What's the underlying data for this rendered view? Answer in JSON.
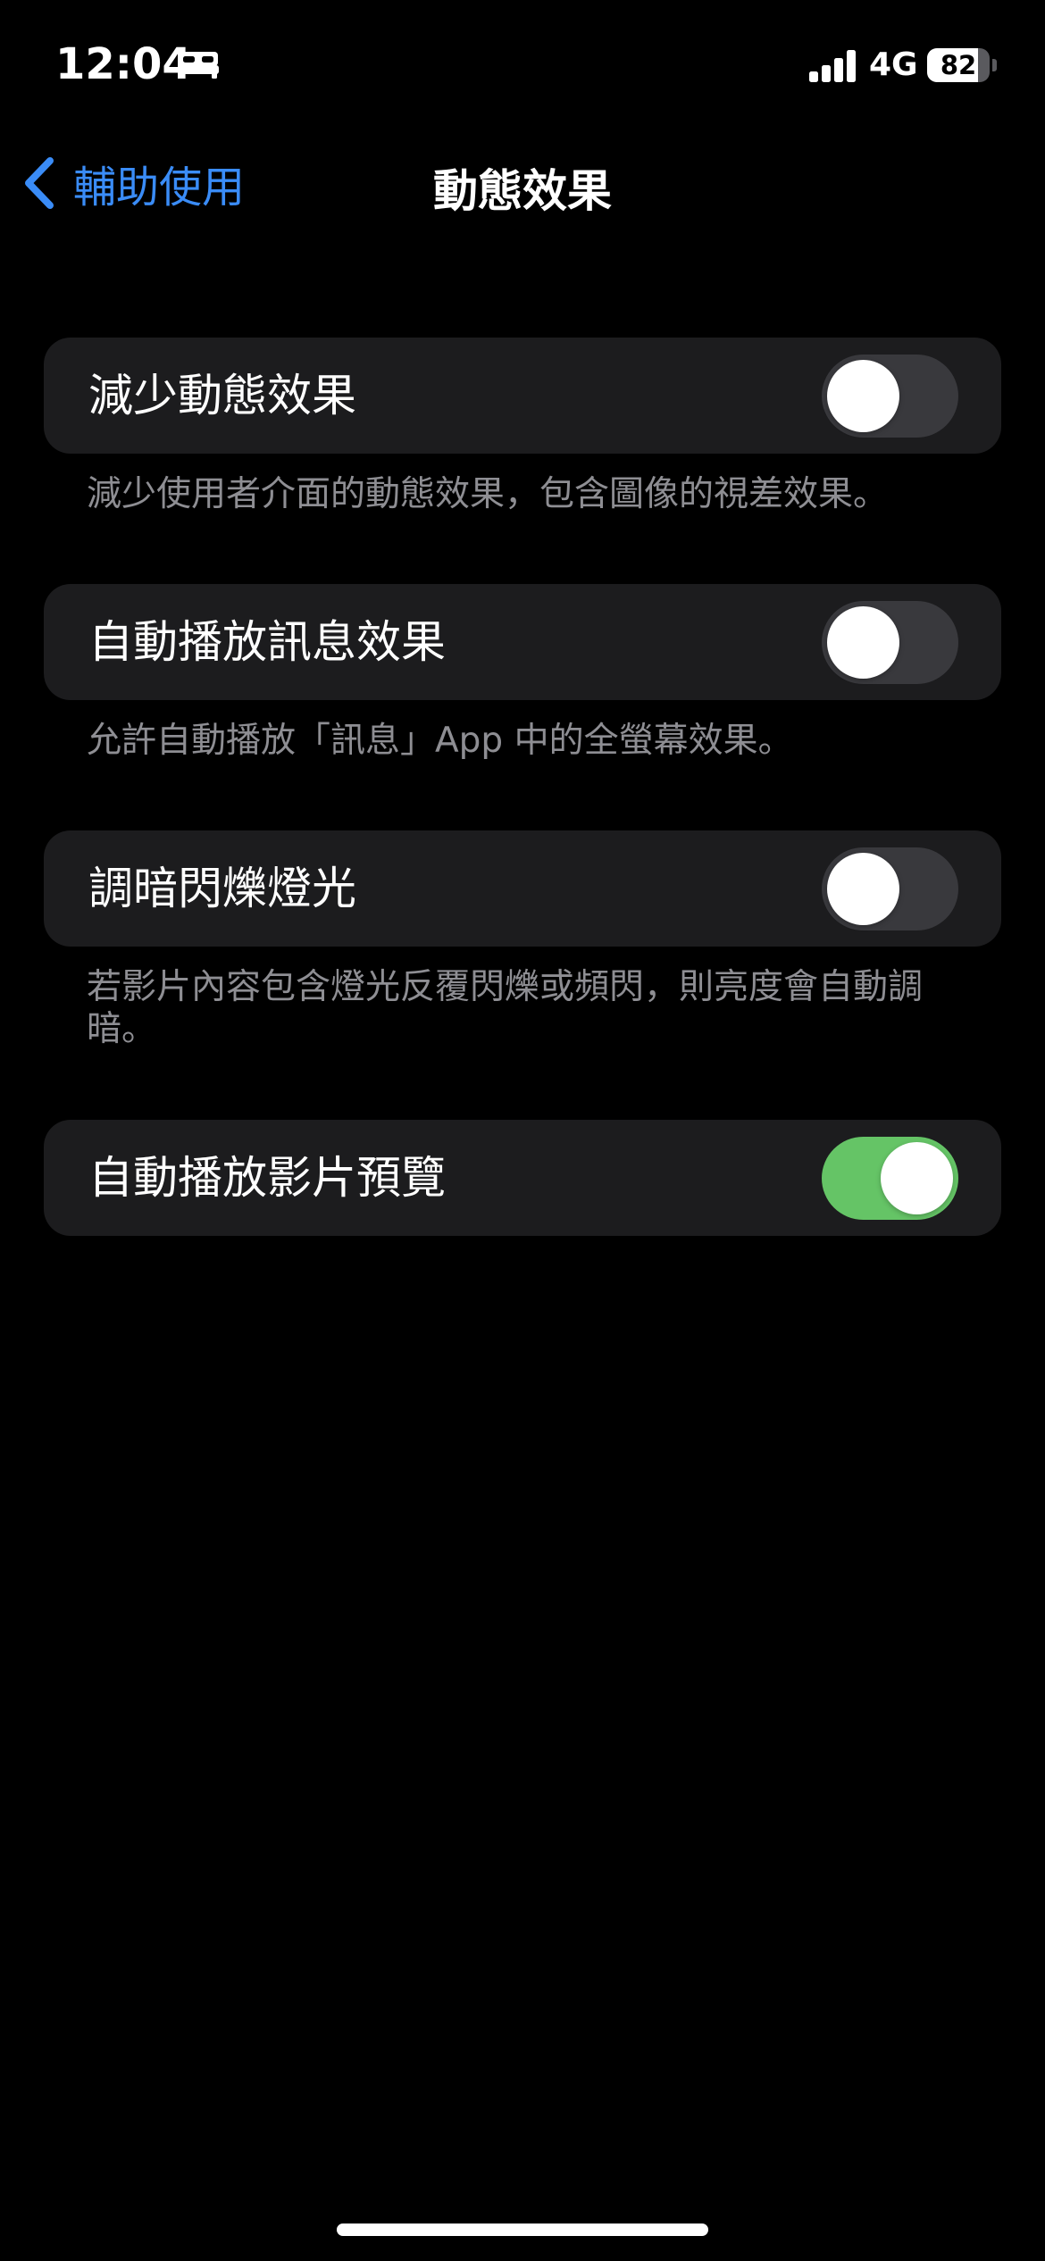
{
  "status_bar": {
    "time": "12:04",
    "sleep_icon": "bed-icon",
    "signal_icon": "cellular-signal-icon",
    "network": "4G",
    "battery_level": "82",
    "battery_fraction": 0.82
  },
  "nav": {
    "back_icon": "chevron-left-icon",
    "back_label": "輔助使用",
    "title": "動態效果"
  },
  "colors": {
    "accent": "#3a8cf7",
    "toggle_on": "#65c466",
    "toggle_off": "#39393d",
    "cell_background": "#1c1c1e",
    "footnote_text": "#8e8e93"
  },
  "settings": [
    {
      "label": "減少動態效果",
      "enabled": false,
      "footnote": "減少使用者介面的動態效果，包含圖像的視差效果。"
    },
    {
      "label": "自動播放訊息效果",
      "enabled": false,
      "footnote": "允許自動播放「訊息」App 中的全螢幕效果。"
    },
    {
      "label": "調暗閃爍燈光",
      "enabled": false,
      "footnote": "若影片內容包含燈光反覆閃爍或頻閃，則亮度會自動調暗。"
    },
    {
      "label": "自動播放影片預覽",
      "enabled": true,
      "footnote": ""
    }
  ]
}
